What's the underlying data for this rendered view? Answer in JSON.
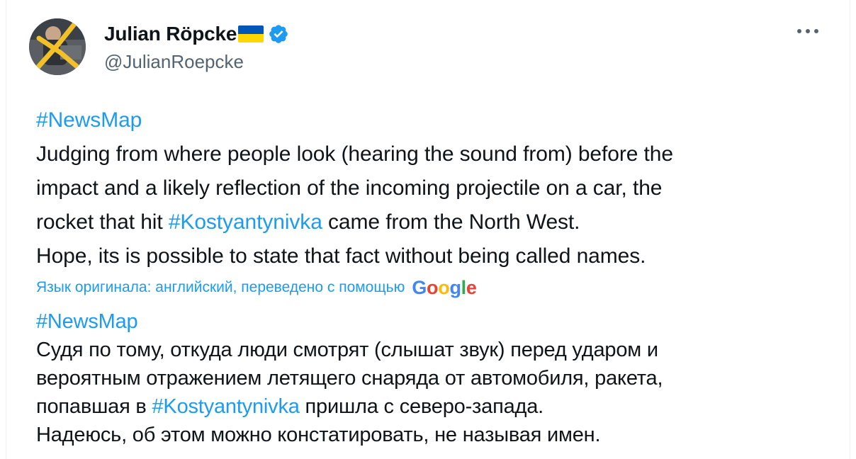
{
  "author": {
    "display_name": "Julian Röpcke",
    "handle": "@JulianRoepcke",
    "flag_icon": "ukraine-flag-icon",
    "verified_icon": "verified-badge-icon",
    "verified_color": "#1d9bf0"
  },
  "menu": {
    "icon": "more-horizontal-icon"
  },
  "tweet_en": {
    "hashtag": "#NewsMap",
    "line1": "Judging from where people look (hearing the sound from) before the",
    "line2": "impact and a likely reflection of the incoming projectile on a car, the",
    "line3_before": "rocket that hit ",
    "line3_tag": "#Kostyantynivka",
    "line3_after": " came from the North West.",
    "line4": "Hope, its is possible to state that fact without being called names."
  },
  "translation": {
    "label": "Язык оригинала: английский, переведено с помощью",
    "provider": "Google",
    "provider_letters": [
      "G",
      "o",
      "o",
      "g",
      "l",
      "e"
    ]
  },
  "tweet_ru": {
    "hashtag": "#NewsMap",
    "line1": "Судя по тому, откуда люди смотрят (слышат звук) перед ударом и",
    "line2": "вероятным отражением летящего снаряда от автомобиля, ракета,",
    "line3_before": "попавшая в ",
    "line3_tag": "#Kostyantynivka",
    "line3_after": " пришла с северо-запада.",
    "line4": "Надеюсь, об этом можно констатировать, не называя имен."
  },
  "colors": {
    "link": "#1d9bf0",
    "text": "#0f1419",
    "secondary": "#536471"
  }
}
